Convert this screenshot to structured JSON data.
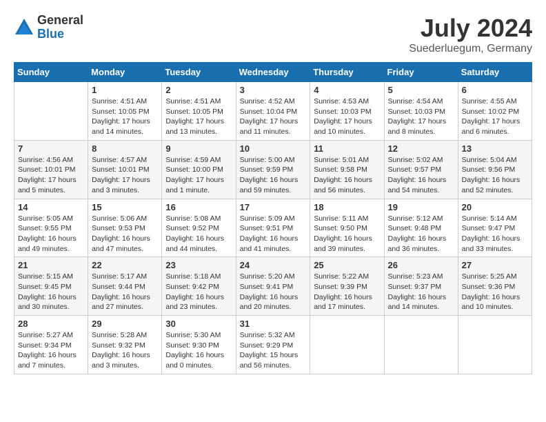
{
  "logo": {
    "general": "General",
    "blue": "Blue"
  },
  "title": {
    "month_year": "July 2024",
    "location": "Suederluegum, Germany"
  },
  "days_of_week": [
    "Sunday",
    "Monday",
    "Tuesday",
    "Wednesday",
    "Thursday",
    "Friday",
    "Saturday"
  ],
  "weeks": [
    [
      {
        "day": "",
        "sunrise": "",
        "sunset": "",
        "daylight": ""
      },
      {
        "day": "1",
        "sunrise": "Sunrise: 4:51 AM",
        "sunset": "Sunset: 10:05 PM",
        "daylight": "Daylight: 17 hours and 14 minutes."
      },
      {
        "day": "2",
        "sunrise": "Sunrise: 4:51 AM",
        "sunset": "Sunset: 10:05 PM",
        "daylight": "Daylight: 17 hours and 13 minutes."
      },
      {
        "day": "3",
        "sunrise": "Sunrise: 4:52 AM",
        "sunset": "Sunset: 10:04 PM",
        "daylight": "Daylight: 17 hours and 11 minutes."
      },
      {
        "day": "4",
        "sunrise": "Sunrise: 4:53 AM",
        "sunset": "Sunset: 10:03 PM",
        "daylight": "Daylight: 17 hours and 10 minutes."
      },
      {
        "day": "5",
        "sunrise": "Sunrise: 4:54 AM",
        "sunset": "Sunset: 10:03 PM",
        "daylight": "Daylight: 17 hours and 8 minutes."
      },
      {
        "day": "6",
        "sunrise": "Sunrise: 4:55 AM",
        "sunset": "Sunset: 10:02 PM",
        "daylight": "Daylight: 17 hours and 6 minutes."
      }
    ],
    [
      {
        "day": "7",
        "sunrise": "Sunrise: 4:56 AM",
        "sunset": "Sunset: 10:01 PM",
        "daylight": "Daylight: 17 hours and 5 minutes."
      },
      {
        "day": "8",
        "sunrise": "Sunrise: 4:57 AM",
        "sunset": "Sunset: 10:01 PM",
        "daylight": "Daylight: 17 hours and 3 minutes."
      },
      {
        "day": "9",
        "sunrise": "Sunrise: 4:59 AM",
        "sunset": "Sunset: 10:00 PM",
        "daylight": "Daylight: 17 hours and 1 minute."
      },
      {
        "day": "10",
        "sunrise": "Sunrise: 5:00 AM",
        "sunset": "Sunset: 9:59 PM",
        "daylight": "Daylight: 16 hours and 59 minutes."
      },
      {
        "day": "11",
        "sunrise": "Sunrise: 5:01 AM",
        "sunset": "Sunset: 9:58 PM",
        "daylight": "Daylight: 16 hours and 56 minutes."
      },
      {
        "day": "12",
        "sunrise": "Sunrise: 5:02 AM",
        "sunset": "Sunset: 9:57 PM",
        "daylight": "Daylight: 16 hours and 54 minutes."
      },
      {
        "day": "13",
        "sunrise": "Sunrise: 5:04 AM",
        "sunset": "Sunset: 9:56 PM",
        "daylight": "Daylight: 16 hours and 52 minutes."
      }
    ],
    [
      {
        "day": "14",
        "sunrise": "Sunrise: 5:05 AM",
        "sunset": "Sunset: 9:55 PM",
        "daylight": "Daylight: 16 hours and 49 minutes."
      },
      {
        "day": "15",
        "sunrise": "Sunrise: 5:06 AM",
        "sunset": "Sunset: 9:53 PM",
        "daylight": "Daylight: 16 hours and 47 minutes."
      },
      {
        "day": "16",
        "sunrise": "Sunrise: 5:08 AM",
        "sunset": "Sunset: 9:52 PM",
        "daylight": "Daylight: 16 hours and 44 minutes."
      },
      {
        "day": "17",
        "sunrise": "Sunrise: 5:09 AM",
        "sunset": "Sunset: 9:51 PM",
        "daylight": "Daylight: 16 hours and 41 minutes."
      },
      {
        "day": "18",
        "sunrise": "Sunrise: 5:11 AM",
        "sunset": "Sunset: 9:50 PM",
        "daylight": "Daylight: 16 hours and 39 minutes."
      },
      {
        "day": "19",
        "sunrise": "Sunrise: 5:12 AM",
        "sunset": "Sunset: 9:48 PM",
        "daylight": "Daylight: 16 hours and 36 minutes."
      },
      {
        "day": "20",
        "sunrise": "Sunrise: 5:14 AM",
        "sunset": "Sunset: 9:47 PM",
        "daylight": "Daylight: 16 hours and 33 minutes."
      }
    ],
    [
      {
        "day": "21",
        "sunrise": "Sunrise: 5:15 AM",
        "sunset": "Sunset: 9:45 PM",
        "daylight": "Daylight: 16 hours and 30 minutes."
      },
      {
        "day": "22",
        "sunrise": "Sunrise: 5:17 AM",
        "sunset": "Sunset: 9:44 PM",
        "daylight": "Daylight: 16 hours and 27 minutes."
      },
      {
        "day": "23",
        "sunrise": "Sunrise: 5:18 AM",
        "sunset": "Sunset: 9:42 PM",
        "daylight": "Daylight: 16 hours and 23 minutes."
      },
      {
        "day": "24",
        "sunrise": "Sunrise: 5:20 AM",
        "sunset": "Sunset: 9:41 PM",
        "daylight": "Daylight: 16 hours and 20 minutes."
      },
      {
        "day": "25",
        "sunrise": "Sunrise: 5:22 AM",
        "sunset": "Sunset: 9:39 PM",
        "daylight": "Daylight: 16 hours and 17 minutes."
      },
      {
        "day": "26",
        "sunrise": "Sunrise: 5:23 AM",
        "sunset": "Sunset: 9:37 PM",
        "daylight": "Daylight: 16 hours and 14 minutes."
      },
      {
        "day": "27",
        "sunrise": "Sunrise: 5:25 AM",
        "sunset": "Sunset: 9:36 PM",
        "daylight": "Daylight: 16 hours and 10 minutes."
      }
    ],
    [
      {
        "day": "28",
        "sunrise": "Sunrise: 5:27 AM",
        "sunset": "Sunset: 9:34 PM",
        "daylight": "Daylight: 16 hours and 7 minutes."
      },
      {
        "day": "29",
        "sunrise": "Sunrise: 5:28 AM",
        "sunset": "Sunset: 9:32 PM",
        "daylight": "Daylight: 16 hours and 3 minutes."
      },
      {
        "day": "30",
        "sunrise": "Sunrise: 5:30 AM",
        "sunset": "Sunset: 9:30 PM",
        "daylight": "Daylight: 16 hours and 0 minutes."
      },
      {
        "day": "31",
        "sunrise": "Sunrise: 5:32 AM",
        "sunset": "Sunset: 9:29 PM",
        "daylight": "Daylight: 15 hours and 56 minutes."
      },
      {
        "day": "",
        "sunrise": "",
        "sunset": "",
        "daylight": ""
      },
      {
        "day": "",
        "sunrise": "",
        "sunset": "",
        "daylight": ""
      },
      {
        "day": "",
        "sunrise": "",
        "sunset": "",
        "daylight": ""
      }
    ]
  ]
}
